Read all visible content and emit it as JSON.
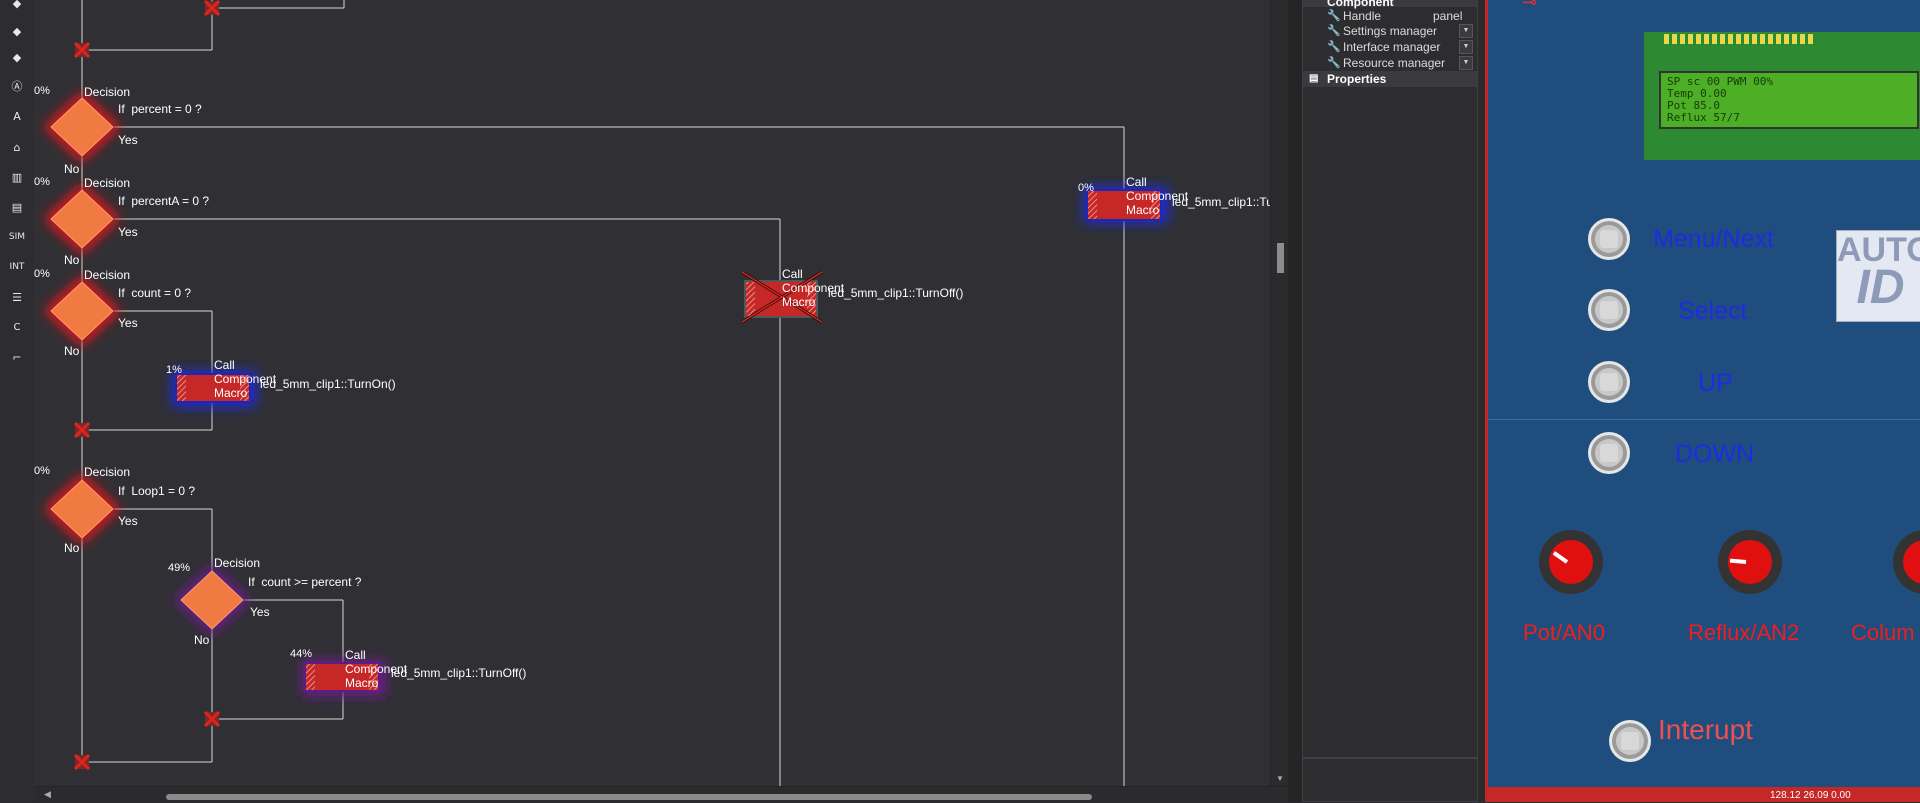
{
  "toolbar": {
    "icons": [
      "decision-icon",
      "switch-icon",
      "connection-point-icon",
      "calculation-icon",
      "component-macro-icon",
      "loop-icon",
      "component-icon",
      "interrupt-icon",
      "simulation-icon",
      "input-output-icon",
      "c-code-icon",
      "comment-icon"
    ],
    "labels": {
      "sim": "SIM",
      "int": "INT",
      "c": "C",
      "a": "A"
    }
  },
  "flowchart": {
    "decisions": [
      {
        "pct": "0%",
        "title": "Decision",
        "cond": "If  percent = 0 ?",
        "yes": "Yes",
        "no": "No"
      },
      {
        "pct": "0%",
        "title": "Decision",
        "cond": "If  percentA = 0 ?",
        "yes": "Yes",
        "no": "No"
      },
      {
        "pct": "0%",
        "title": "Decision",
        "cond": "If  count = 0 ?",
        "yes": "Yes",
        "no": "No"
      },
      {
        "pct": "0%",
        "title": "Decision",
        "cond": "If  Loop1 = 0 ?",
        "yes": "Yes",
        "no": "No"
      },
      {
        "pct": "49%",
        "title": "Decision",
        "cond": "If  count >= percent ?",
        "yes": "Yes",
        "no": "No"
      }
    ],
    "macros": [
      {
        "pct": "1%",
        "title": "Call Component Macro",
        "call": "led_5mm_clip1::TurnOn()"
      },
      {
        "pct": "",
        "title": "Call Component Macro",
        "call": "led_5mm_clip1::TurnOff()"
      },
      {
        "pct": "0%",
        "title": "Call Component Macro",
        "call": "led_5mm_clip1::Tu"
      },
      {
        "pct": "44%",
        "title": "Call Component Macro",
        "call": "led_5mm_clip1::TurnOff()"
      }
    ]
  },
  "properties": {
    "section": "Component",
    "rows": [
      {
        "key": "Handle",
        "value": "panel"
      },
      {
        "key": "Settings manager",
        "value": ""
      },
      {
        "key": "Interface manager",
        "value": ""
      },
      {
        "key": "Resource manager",
        "value": ""
      }
    ],
    "properties_label": "Properties"
  },
  "panel": {
    "lcd_lines": [
      "SP  sc  00  PWM  00%",
      "Temp         0.00",
      "Pot        85.0",
      "Reflux     57/7"
    ],
    "buttons": [
      "Menu/Next",
      "Select",
      "UP",
      "DOWN"
    ],
    "knobs": [
      "Pot/AN0",
      "Reflux/AN2",
      "Colum"
    ],
    "interrupt": "Interupt",
    "autoid_top": "AUTO",
    "autoid_bottom": "ID",
    "status": "128.12   26.09  0.00"
  },
  "colors": {
    "canvas": "#303034",
    "decision_fill": "#f07a42",
    "decision_glow_red": "#e4161c",
    "decision_glow_purple": "#6a1b8c",
    "macro_fill": "#c62727",
    "panel_bg": "#1e4d7e"
  }
}
